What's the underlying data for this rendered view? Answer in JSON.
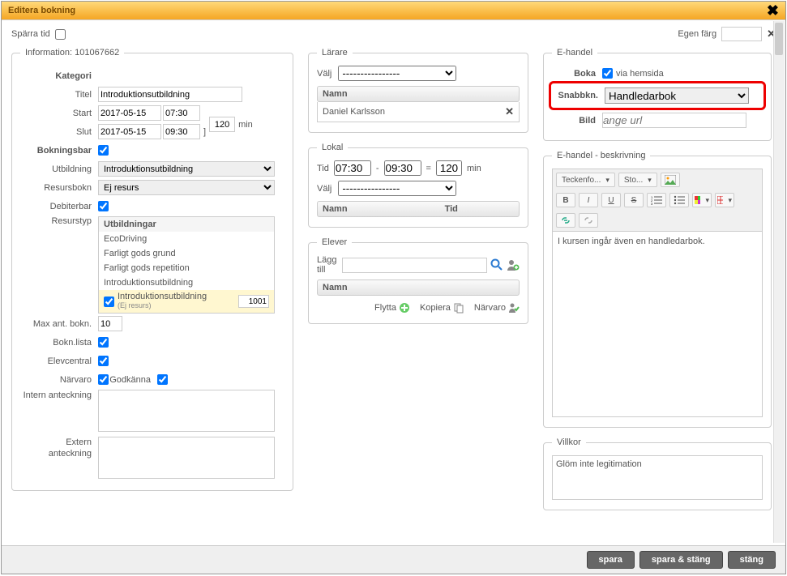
{
  "dialog": {
    "title": "Editera bokning"
  },
  "topbar": {
    "sparra_tid": "Spärra tid",
    "egen_farg": "Egen färg"
  },
  "info": {
    "legend": "Information: 101067662",
    "kategori": "Kategori",
    "titel_lbl": "Titel",
    "titel": "Introduktionsutbildning",
    "start_lbl": "Start",
    "start_date": "2017-05-15",
    "start_time": "07:30",
    "slut_lbl": "Slut",
    "slut_date": "2017-05-15",
    "slut_time": "09:30",
    "duration": "120",
    "min": "min",
    "bracket": "]",
    "bokningsbar": "Bokningsbar",
    "utbildning_lbl": "Utbildning",
    "utbildning": "Introduktionsutbildning",
    "resursbokn_lbl": "Resursbokn",
    "resursbokn": "Ej resurs",
    "debiterbar": "Debiterbar",
    "resurstyp_lbl": "Resurstyp",
    "resurstyp": {
      "header": "Utbildningar",
      "items": [
        "EcoDriving",
        "Farligt gods grund",
        "Farligt gods repetition",
        "Introduktionsutbildning"
      ],
      "selected": {
        "label": "Introduktionsutbildning",
        "sub": "(Ej resurs)",
        "val": "1001"
      }
    },
    "max_ant_lbl": "Max ant. bokn.",
    "max_ant": "10",
    "bokn_lista": "Bokn.lista",
    "elevcentral": "Elevcentral",
    "narvaro": "Närvaro",
    "godkanna": "Godkänna",
    "intern": "Intern anteckning",
    "extern": "Extern anteckning"
  },
  "larare": {
    "legend": "Lärare",
    "valj": "Välj",
    "valj_val": "----------------",
    "namn": "Namn",
    "teacher": "Daniel Karlsson"
  },
  "lokal": {
    "legend": "Lokal",
    "tid": "Tid",
    "t1": "07:30",
    "dash": "-",
    "t2": "09:30",
    "eq": "=",
    "dur": "120",
    "min": "min",
    "valj": "Välj",
    "valj_val": "----------------",
    "namn": "Namn",
    "tid_col": "Tid"
  },
  "elever": {
    "legend": "Elever",
    "lagg_till": "Lägg till",
    "namn": "Namn",
    "flytta": "Flytta",
    "kopiera": "Kopiera",
    "narvaro": "Närvaro"
  },
  "ehandel": {
    "legend": "E-handel",
    "boka": "Boka",
    "via_hemsida": "via hemsida",
    "snabbkn": "Snabbkn.",
    "snabbkn_val": "Handledarbok",
    "bild": "Bild",
    "bild_ph": "ange url"
  },
  "ehandel_beskr": {
    "legend": "E-handel - beskrivning",
    "font_btn": "Teckenfo...",
    "size_btn": "Sto...",
    "body": "I kursen ingår även en handledarbok."
  },
  "villkor": {
    "legend": "Villkor",
    "body": "Glöm inte legitimation"
  },
  "buttons": {
    "spara": "spara",
    "spara_stang": "spara & stäng",
    "stang": "stäng"
  },
  "glyph": {
    "bracket_close": "]",
    "bold": "B",
    "italic": "I",
    "underline": "U",
    "strike": "S"
  }
}
